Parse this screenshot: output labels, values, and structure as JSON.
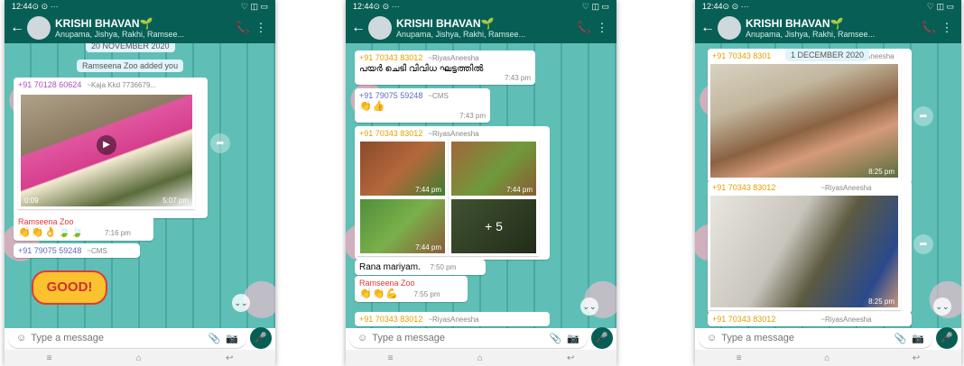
{
  "status": {
    "time": "12:44",
    "icons": "⊙ ⊙ ···",
    "right": "♡ ◫ ▭"
  },
  "header": {
    "title": "KRISHI BHAVAN",
    "leaf": "🌱",
    "back": "←",
    "call": "📞",
    "menu": "⋮"
  },
  "phones": [
    {
      "subtitle": "Anupama, Jishya, Rakhi, Ramsee...",
      "date_chip": "20 NOVEMBER 2020",
      "system_msg": "Ramseena Zoo added you",
      "msg1": {
        "sender": "+91 70128 60624",
        "alias": "~Kaja Kkd 7736679...",
        "duration": "0:09",
        "time": "5:07 pm"
      },
      "msg2": {
        "sender": "Ramseena Zoo",
        "emoji": "👏👏👌🍃🍃",
        "time": "7:16 pm"
      },
      "msg3": {
        "sender": "+91 79075 59248",
        "alias": "~CMS"
      },
      "sticker": "GOOD!"
    },
    {
      "subtitle": "Anupama, Jishya, Rakhi, Ramsee...",
      "msg1": {
        "sender": "+91 70343 83012",
        "alias": "~RiyasAneesha",
        "text": "പയർ ചെടി വിവിധ ഘട്ടത്തിൽ",
        "time": "7:43 pm"
      },
      "msg2": {
        "sender": "+91 79075 59248",
        "alias": "~CMS",
        "emoji": "👏👍",
        "time": "7:43 pm"
      },
      "msg3": {
        "sender": "+91 70343 83012",
        "alias": "~RiyasAneesha",
        "t1": "7:44 pm",
        "t2": "7:44 pm",
        "t3": "7:44 pm",
        "more": "+ 5"
      },
      "msg4": {
        "text": "Rana mariyam.",
        "time": "7:50 pm"
      },
      "msg5": {
        "sender": "Ramseena Zoo",
        "emoji": "👏👏💪",
        "time": "7:55 pm"
      },
      "msg6": {
        "sender": "+91 70343 83012",
        "alias": "~RiyasAneesha"
      }
    },
    {
      "subtitle": "Anupama, Jishya, Rakhi, Ramsee...",
      "date_chip": "1 DECEMBER 2020",
      "msg1": {
        "sender": "+91 70343 8301",
        "alias": "~RiyasAneesha",
        "time": "8:25 pm"
      },
      "msg2": {
        "sender": "+91 70343 83012",
        "alias": "~RiyasAneesha",
        "time": "8:25 pm"
      },
      "msg3": {
        "sender": "+91 70343 83012",
        "alias": "~RiyasAneesha"
      }
    }
  ],
  "input": {
    "placeholder": "Type a message"
  },
  "icons": {
    "emoji": "☺",
    "attach": "📎",
    "camera": "📷",
    "mic": "🎤",
    "forward": "➦",
    "scroll_down": "⌄⌄"
  },
  "navbar": {
    "menu": "≡",
    "home": "⌂",
    "back": "↩"
  }
}
